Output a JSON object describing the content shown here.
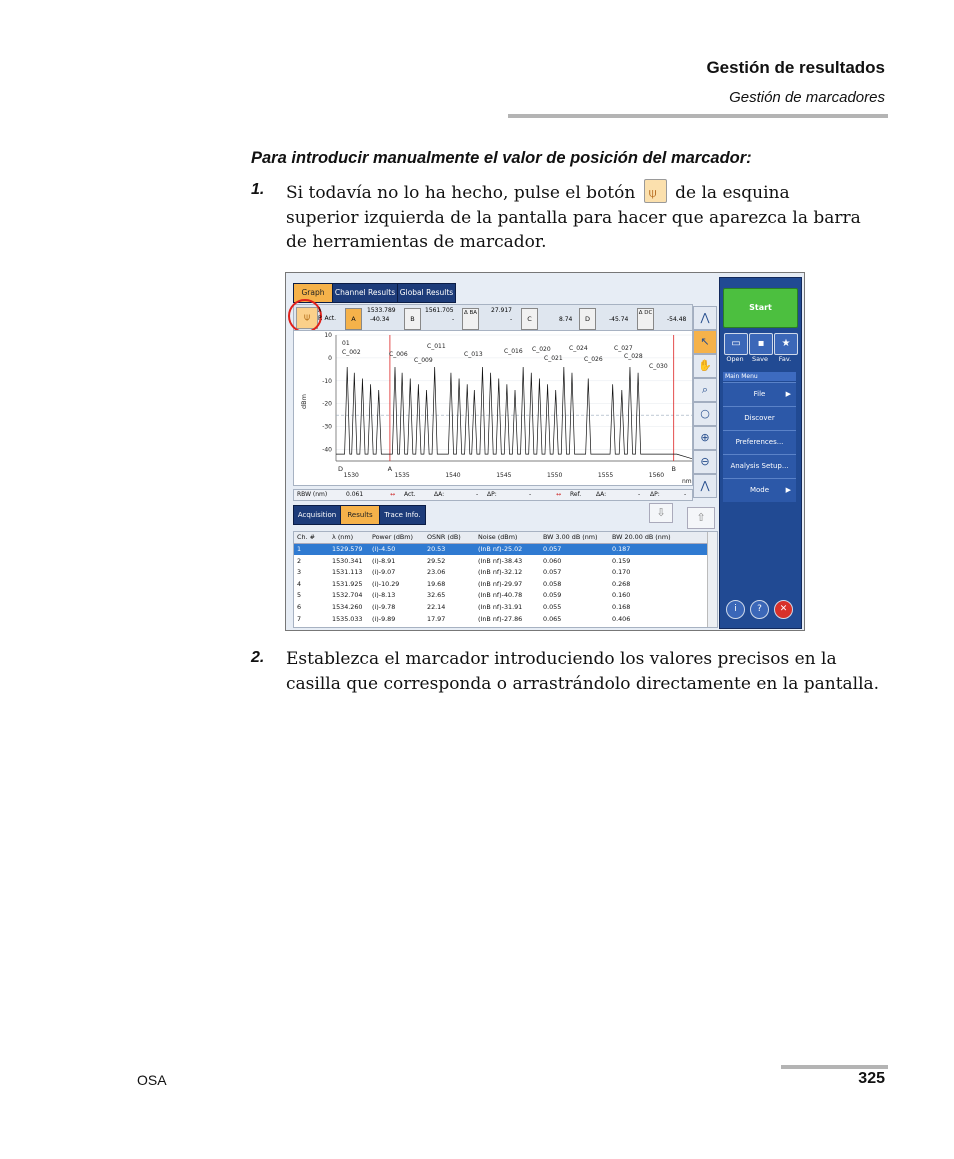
{
  "header": {
    "title": "Gestión de resultados",
    "subtitle": "Gestión de marcadores"
  },
  "procedure_title": "Para introducir manualmente el valor de posición del marcador:",
  "steps": [
    {
      "num": "1.",
      "text_a": "Si todavía no lo ha hecho, pulse el botón",
      "text_b": "de la esquina superior izquierda de la pantalla para hacer que aparezca la barra de herramientas de marcador."
    },
    {
      "num": "2.",
      "text": "Establezca el marcador introduciendo los valores precisos en la casilla que corresponda o arrastrándolo directamente en la pantalla."
    }
  ],
  "screenshot": {
    "top_tabs": [
      "Graph",
      "Channel Results",
      "Global Results"
    ],
    "marker_bar": {
      "p_act": "P. Act.",
      "a_label": "A",
      "a_top": "1533.789",
      "a_val": "-40.34",
      "b_label": "B",
      "b_top": "1561.705",
      "b_val": "-",
      "ba_label": "Δ BA",
      "ba_top": "27.917",
      "ba_val": "-",
      "c_label": "C",
      "c_val": "8.74",
      "d_label": "D",
      "d_val": "-45.74",
      "dc_label": "Δ DC",
      "dc_val": "-54.48",
      "lambda": "λ"
    },
    "plot": {
      "ylabel": "dBm",
      "xunit": "nm",
      "yticks": [
        "10",
        "0",
        "-10",
        "-20",
        "-30",
        "-40"
      ],
      "xticks": [
        "1530",
        "1535",
        "1540",
        "1545",
        "1550",
        "1555",
        "1560"
      ],
      "channel_labels": [
        "01",
        "C_002",
        "C_006",
        "C_009",
        "C_011",
        "C_013",
        "C_016",
        "C_020",
        "C_021",
        "C_024",
        "C_026",
        "C_027",
        "C_028",
        "C_030"
      ],
      "marker_letters": [
        "A",
        "B",
        "D"
      ]
    },
    "info_bar": {
      "rbw_label": "RBW (nm)",
      "rbw_val": "0.061",
      "act": "Act.",
      "da": "ΔA:",
      "da_val": "-",
      "dp": "ΔP:",
      "dp_val": "-",
      "ref": "Ref.",
      "da2": "ΔA:",
      "da2_val": "-",
      "dp2": "ΔP:",
      "dp2_val": "-"
    },
    "bottom_tabs": [
      "Acquisition",
      "Results",
      "Trace Info."
    ],
    "table": {
      "headers": [
        "Ch. #",
        "λ (nm)",
        "Power (dBm)",
        "OSNR (dB)",
        "Noise (dBm)",
        "BW 3.00 dB (nm)",
        "BW 20.00 dB (nm)"
      ],
      "rows": [
        [
          "1",
          "1529.579",
          "(i)-4.50",
          "20.53",
          "(InB nf)-25.02",
          "0.057",
          "0.187"
        ],
        [
          "2",
          "1530.341",
          "(i)-8.91",
          "29.52",
          "(InB nf)-38.43",
          "0.060",
          "0.159"
        ],
        [
          "3",
          "1531.113",
          "(i)-9.07",
          "23.06",
          "(InB nf)-32.12",
          "0.057",
          "0.170"
        ],
        [
          "4",
          "1531.925",
          "(i)-10.29",
          "19.68",
          "(InB nf)-29.97",
          "0.058",
          "0.268"
        ],
        [
          "5",
          "1532.704",
          "(i)-8.13",
          "32.65",
          "(InB nf)-40.78",
          "0.059",
          "0.160"
        ],
        [
          "6",
          "1534.260",
          "(i)-9.78",
          "22.14",
          "(InB nf)-31.91",
          "0.055",
          "0.168"
        ],
        [
          "7",
          "1535.033",
          "(i)-9.89",
          "17.97",
          "(InB nf)-27.86",
          "0.065",
          "0.406"
        ]
      ]
    },
    "right_panel": {
      "start": "Start",
      "buttons": [
        "Open",
        "Save",
        "Fav."
      ],
      "main_menu": "Main Menu",
      "menu": [
        "File",
        "Discover",
        "Preferences...",
        "Analysis Setup...",
        "Mode"
      ]
    }
  },
  "footer": {
    "left": "OSA",
    "page": "325"
  },
  "colors": {
    "accent": "#f5b24a",
    "panel_blue": "#214a93",
    "start_green": "#4cbf3f",
    "highlight_red": "#e0201a"
  }
}
